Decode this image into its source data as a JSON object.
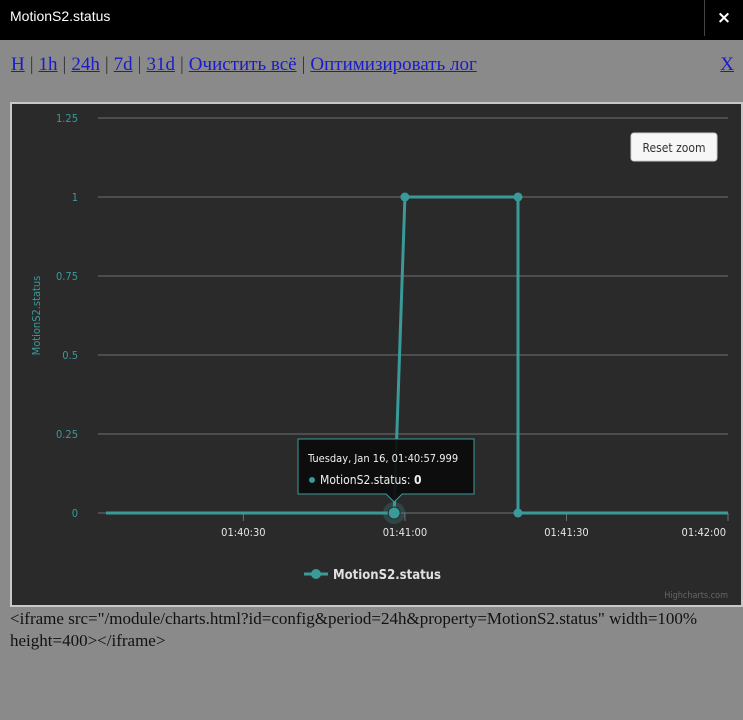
{
  "window": {
    "title": "MotionS2.status",
    "close_label": "×"
  },
  "nav": {
    "links": [
      "H",
      "1h",
      "24h",
      "7d",
      "31d",
      "Очистить всё",
      "Оптимизировать лог"
    ],
    "close_label": "X"
  },
  "reset_zoom_label": "Reset zoom",
  "tooltip": {
    "title": "Tuesday, Jan 16, 01:40:57.999",
    "series": "MotionS2.status",
    "value": "0"
  },
  "credits": "Highcharts.com",
  "embed_code": "<iframe src=\"/module/charts.html?id=config&period=24h&property=MotionS2.status\" width=100% height=400></iframe>",
  "colors": {
    "series": "#3a9a9a",
    "background": "#2a2a2b",
    "gridline": "#707073"
  },
  "chart_data": {
    "type": "line",
    "step": true,
    "ylabel": "MotionS2.status",
    "ylim": [
      0,
      1.25
    ],
    "yticks": [
      "0",
      "0.25",
      "0.5",
      "0.75",
      "1",
      "1.25"
    ],
    "xlim": [
      "01:40:03",
      "01:42:00"
    ],
    "xticks": [
      "01:40:30",
      "01:41:00",
      "01:41:30",
      "01:42:00"
    ],
    "legend": "bottom-center",
    "series": [
      {
        "name": "MotionS2.status",
        "points": [
          {
            "x": "01:40:57.999",
            "y": 0
          },
          {
            "x": "01:41:00",
            "y": 1
          },
          {
            "x": "01:41:21",
            "y": 1
          },
          {
            "x": "01:41:21",
            "y": 0
          },
          {
            "x": "01:42:00",
            "y": 0
          }
        ]
      }
    ]
  }
}
